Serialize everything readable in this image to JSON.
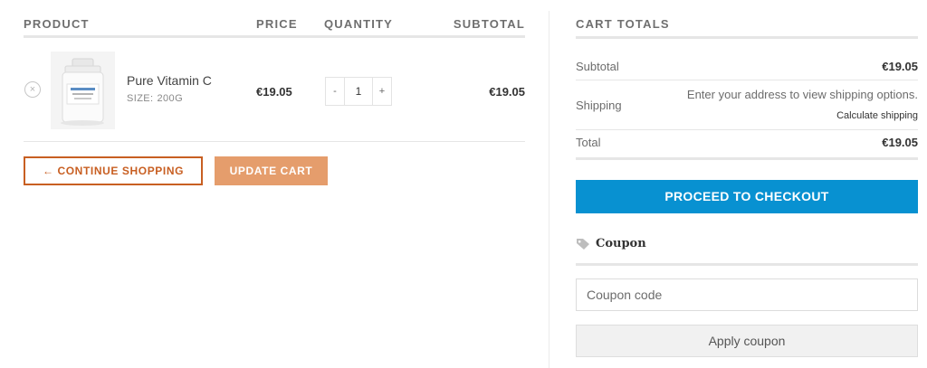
{
  "cart": {
    "headers": {
      "product": "Product",
      "price": "Price",
      "quantity": "Quantity",
      "subtotal": "Subtotal"
    },
    "items": [
      {
        "remove_icon": "×",
        "name": "Pure Vitamin C",
        "meta_label": "SIZE:",
        "meta_value": "200G",
        "price": "€19.05",
        "qty_minus": "-",
        "quantity": "1",
        "qty_plus": "+",
        "subtotal": "€19.05"
      }
    ],
    "continue_label": "← Continue Shopping",
    "update_label": "Update Cart"
  },
  "totals": {
    "title": "Cart Totals",
    "subtotal_label": "Subtotal",
    "subtotal_value": "€19.05",
    "shipping_label": "Shipping",
    "shipping_note": "Enter your address to view shipping options.",
    "shipping_calc": "Calculate shipping",
    "total_label": "Total",
    "total_value": "€19.05",
    "checkout_label": "Proceed to Checkout"
  },
  "coupon": {
    "icon": "tag-icon",
    "title": "Coupon",
    "placeholder": "Coupon code",
    "apply_label": "Apply coupon"
  },
  "colors": {
    "accent_orange": "#c85f22",
    "update_button": "#e59d6c",
    "checkout_blue": "#0891d1"
  }
}
